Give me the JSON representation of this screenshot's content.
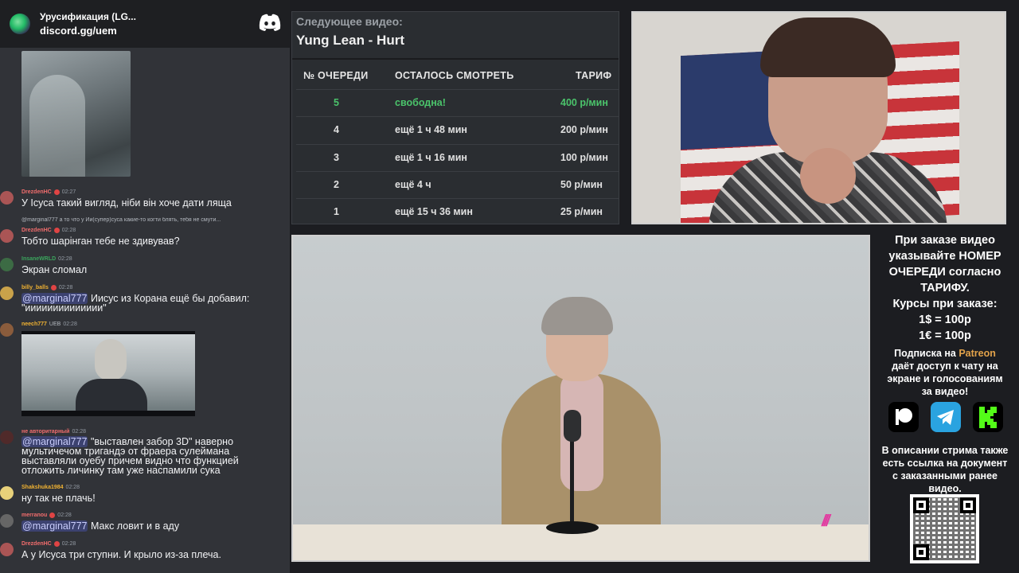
{
  "chat": {
    "server_name": "Урусификация (LG...",
    "server_link": "discord.gg/uem",
    "messages": [
      {
        "user": "DrezdenHC",
        "time": "02:27",
        "color": "#f26d6d",
        "text": "У Ісуса такий вигляд, ніби він хоче дати ляща"
      },
      {
        "user": "DrezdenHC",
        "time": "02:28",
        "color": "#f26d6d",
        "reply": "@marginal777 а то что у Ии(супер)суса какие-то когти блять, тебя не смути...",
        "text": "Тобто шарінган тебе не здивував?"
      },
      {
        "user": "InsaneWRLD",
        "time": "02:28",
        "color": "#3ba55d",
        "text": "Экран сломал"
      },
      {
        "user": "billy_balls",
        "time": "02:28",
        "color": "#f0b232",
        "mention": "@marginal777",
        "text": "Иисус из Корана ещё бы добавил: \"ииииииииииииии\""
      },
      {
        "user": "neech777",
        "tag": "UEB",
        "time": "02:28",
        "color": "#f0b232"
      },
      {
        "user": "не авторитарный",
        "time": "02:28",
        "color": "#f26d6d",
        "mention": "@marginal777",
        "text_1": "\"выставлен забор 3D\" наверно",
        "text_2": "мультичечом тригандэ от фраера сулеймана",
        "text_3": "выставляли оуебу причем видно что функцией",
        "text_4": "отложить личинку там уже наспамили сука"
      },
      {
        "user": "Shakshuka1984",
        "time": "02:28",
        "color": "#f0b232",
        "text": "ну так не плачь!"
      },
      {
        "user": "merranou",
        "time": "02:28",
        "color": "#f26d6d",
        "mention": "@marginal777",
        "text": "Макс ловит и в аду"
      },
      {
        "user": "DrezdenHC",
        "time": "02:28",
        "color": "#f26d6d",
        "text": "А у Исуса три ступни. И крыло из-за плеча."
      }
    ]
  },
  "queue": {
    "next_label": "Следующее видео:",
    "next_title": "Yung Lean - Hurt",
    "headers": {
      "position": "№ ОЧЕРЕДИ",
      "remaining": "ОСТАЛОСЬ СМОТРЕТЬ",
      "tariff": "ТАРИФ"
    },
    "rows": [
      {
        "position": "5",
        "remaining": "свободна!",
        "tariff": "400 р/мин"
      },
      {
        "position": "4",
        "remaining": "ещё 1 ч 48 мин",
        "tariff": "200 р/мин"
      },
      {
        "position": "3",
        "remaining": "ещё 1 ч 16 мин",
        "tariff": "100 р/мин"
      },
      {
        "position": "2",
        "remaining": "ещё 4 ч",
        "tariff": "50 р/мин"
      },
      {
        "position": "1",
        "remaining": "ещё 15 ч 36 мин",
        "tariff": "25 р/мин"
      }
    ]
  },
  "info": {
    "order_1": "При заказе видео",
    "order_2": "указывайте НОМЕР",
    "order_3": "ОЧЕРЕДИ согласно",
    "order_4": "ТАРИФУ.",
    "rates_title": "Курсы при заказе:",
    "rate_usd": "1$ = 100р",
    "rate_eur": "1€ = 100р",
    "sub_1_pre": "Подписка на ",
    "sub_1_brand": "Patreon",
    "sub_2": "даёт доступ к чату на",
    "sub_3": "экране и голосованиям",
    "sub_4": "за видео!",
    "desc_1": "В описании стрима также",
    "desc_2": "есть ссылка на документ",
    "desc_3": "с заказанными ранее",
    "desc_4": "видео.",
    "icons": [
      "patreon-icon",
      "telegram-icon",
      "kick-icon"
    ],
    "colors": {
      "patreon": "#ffffff",
      "telegram": "#2aa3e0",
      "kick": "#53fc18"
    }
  },
  "video": {
    "logo": "///"
  }
}
